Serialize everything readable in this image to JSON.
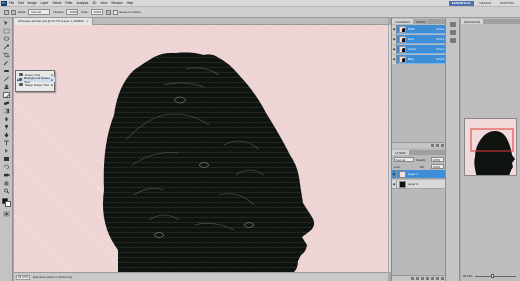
{
  "app": {
    "logo": "Ps"
  },
  "menu": {
    "items": [
      "File",
      "Edit",
      "Image",
      "Layer",
      "Select",
      "Filter",
      "Analysis",
      "3D",
      "View",
      "Window",
      "Help"
    ]
  },
  "workspaces": [
    {
      "label": "ESSENTIALS",
      "active": true
    },
    {
      "label": "DESIGN",
      "active": false
    },
    {
      "label": "PAINTING",
      "active": false
    }
  ],
  "options": {
    "mode_label": "Mode:",
    "mode_value": "Normal",
    "opacity_label": "Opacity:",
    "opacity_value": "100%",
    "flow_label": "Flow:",
    "flow_value": "100%",
    "erase_label": "Erase to History"
  },
  "document": {
    "tab_title": "silhouette-portrait.psd @ 66.7% (Layer 1, RGB/8)",
    "close": "×"
  },
  "flyout": {
    "items": [
      {
        "label": "Eraser Tool",
        "key": "E",
        "selected": false
      },
      {
        "label": "Background Eraser Tool",
        "key": "E",
        "selected": true
      },
      {
        "label": "Magic Eraser Tool",
        "key": "E",
        "selected": false
      }
    ]
  },
  "status": {
    "zoom": "66.67%",
    "text": "Exposure works in 32-bit only"
  },
  "channels": {
    "tabs": [
      "CHANNELS",
      "PATHS"
    ],
    "rows": [
      {
        "label": "RGB",
        "key": "Ctrl+2"
      },
      {
        "label": "Red",
        "key": "Ctrl+3"
      },
      {
        "label": "Green",
        "key": "Ctrl+4"
      },
      {
        "label": "Blue",
        "key": "Ctrl+5"
      }
    ]
  },
  "layers": {
    "tabs": [
      "LAYERS"
    ],
    "blend_mode": "Normal",
    "opacity_label": "Opacity:",
    "opacity_value": "100%",
    "lock_label": "Lock:",
    "fill_label": "Fill:",
    "fill_value": "100%",
    "rows": [
      {
        "label": "Layer 1",
        "selected": true,
        "thumb": "pink"
      },
      {
        "label": "Layer 0",
        "selected": false,
        "thumb": "black"
      }
    ]
  },
  "navigator": {
    "tabs": [
      "NAVIGATOR"
    ],
    "zoom": "66.67%"
  },
  "colors": {
    "canvas_bg": "#f3dcdc",
    "silhouette": "#0f130f",
    "selection_blue": "#3d8ed6",
    "proxy_view_box": "#e2383f"
  },
  "icons": {
    "tools": [
      "move-icon",
      "marquee-icon",
      "lasso-icon",
      "quick-select-icon",
      "crop-icon",
      "eyedropper-icon",
      "healing-icon",
      "brush-icon",
      "clone-stamp-icon",
      "history-brush-icon",
      "eraser-icon",
      "gradient-icon",
      "blur-icon",
      "dodge-icon",
      "pen-icon",
      "type-icon",
      "path-select-icon",
      "shape-icon",
      "3d-rotate-icon",
      "3d-camera-icon",
      "hand-icon",
      "zoom-icon"
    ]
  }
}
